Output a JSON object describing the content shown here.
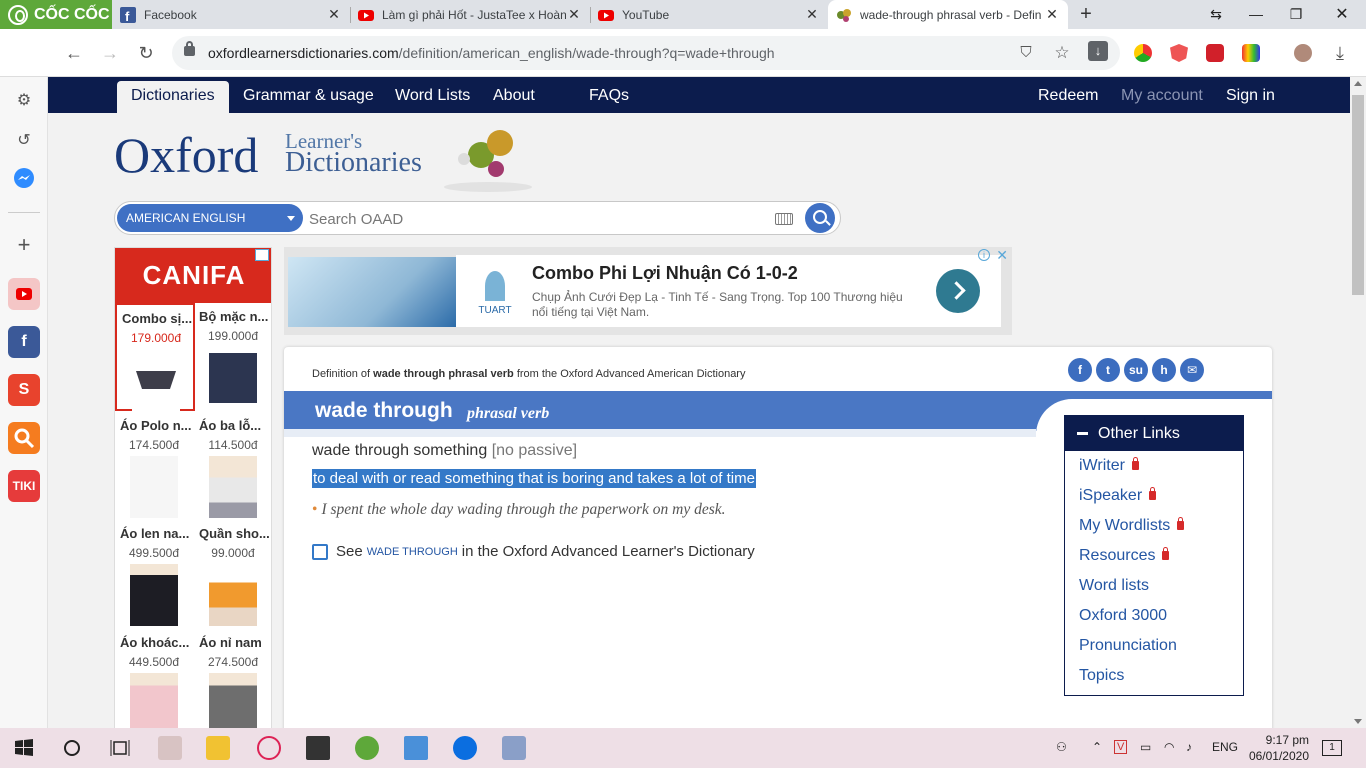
{
  "browser": {
    "brand": "CỐC CỐC",
    "tabs": [
      {
        "title": "Facebook"
      },
      {
        "title": "Làm gì phải Hốt - JustaTee x Hoàng"
      },
      {
        "title": "YouTube"
      },
      {
        "title": "wade-through phrasal verb - Defin"
      }
    ],
    "url_host": "oxfordlearnersdictionaries.com",
    "url_path": "/definition/american_english/wade-through?q=wade+through"
  },
  "nav": {
    "items": [
      "Dictionaries",
      "Grammar & usage",
      "Word Lists",
      "About",
      "FAQs"
    ],
    "right": [
      "Redeem",
      "My account",
      "Sign in"
    ]
  },
  "logo": {
    "oxford": "Oxford",
    "learners": "Learner's",
    "dictionaries": "Dictionaries"
  },
  "search": {
    "dropdown": "AMERICAN ENGLISH",
    "placeholder": "Search OAAD"
  },
  "left_ad": {
    "brand": "CANIFA",
    "products": [
      {
        "name": "Combo sị...",
        "price": "179.000đ"
      },
      {
        "name": "Bộ mặc n...",
        "price": "199.000đ"
      },
      {
        "name": "Áo Polo n...",
        "price": "174.500đ"
      },
      {
        "name": "Áo ba lỗ...",
        "price": "114.500đ"
      },
      {
        "name": "Áo len na...",
        "price": "499.500đ"
      },
      {
        "name": "Quần sho...",
        "price": "99.000đ"
      },
      {
        "name": "Áo khoác...",
        "price": "449.500đ"
      },
      {
        "name": "Áo nỉ nam",
        "price": "274.500đ"
      }
    ]
  },
  "top_ad": {
    "headline": "Combo Phi Lợi Nhuận Có 1-0-2",
    "description": "Chụp Ảnh Cưới Đẹp Lạ - Tinh Tế - Sang Trọng. Top 100 Thương hiệu nổi tiếng tại Việt Nam.",
    "brand": "TUART"
  },
  "entry": {
    "def_prefix": "Definition of",
    "def_word": "wade through phrasal verb",
    "def_suffix": "from the Oxford Advanced American Dictionary",
    "headword": "wade through",
    "pos": "phrasal verb",
    "sense": "wade through something",
    "grammar": "[no passive]",
    "definition": "to deal with or read something that is boring and takes a lot of time",
    "example": "I spent the whole day wading through the paperwork on my desk.",
    "see_prefix": "See",
    "see_word": "wade through",
    "see_suffix": "in the Oxford Advanced Learner's Dictionary",
    "social_icons": [
      "facebook-icon",
      "twitter-icon",
      "stumbleupon-icon",
      "hi5-icon",
      "email-icon"
    ]
  },
  "other_links": {
    "title": "Other Links",
    "items": [
      {
        "label": "iWriter",
        "locked": true
      },
      {
        "label": "iSpeaker",
        "locked": true
      },
      {
        "label": "My Wordlists",
        "locked": true
      },
      {
        "label": "Resources",
        "locked": true
      },
      {
        "label": "Word lists",
        "locked": false
      },
      {
        "label": "Oxford 3000",
        "locked": false
      },
      {
        "label": "Pronunciation",
        "locked": false
      },
      {
        "label": "Topics",
        "locked": false
      }
    ]
  },
  "taskbar": {
    "time": "9:17 pm",
    "date": "06/01/2020",
    "lang": "ENG",
    "notifications": "1"
  },
  "colors": {
    "nav_bg": "#0c1c4d",
    "brand_green": "#5ea83a",
    "oxford_blue": "#4a77c4",
    "selection": "#3479c8",
    "lock_red": "#d62a2a"
  }
}
